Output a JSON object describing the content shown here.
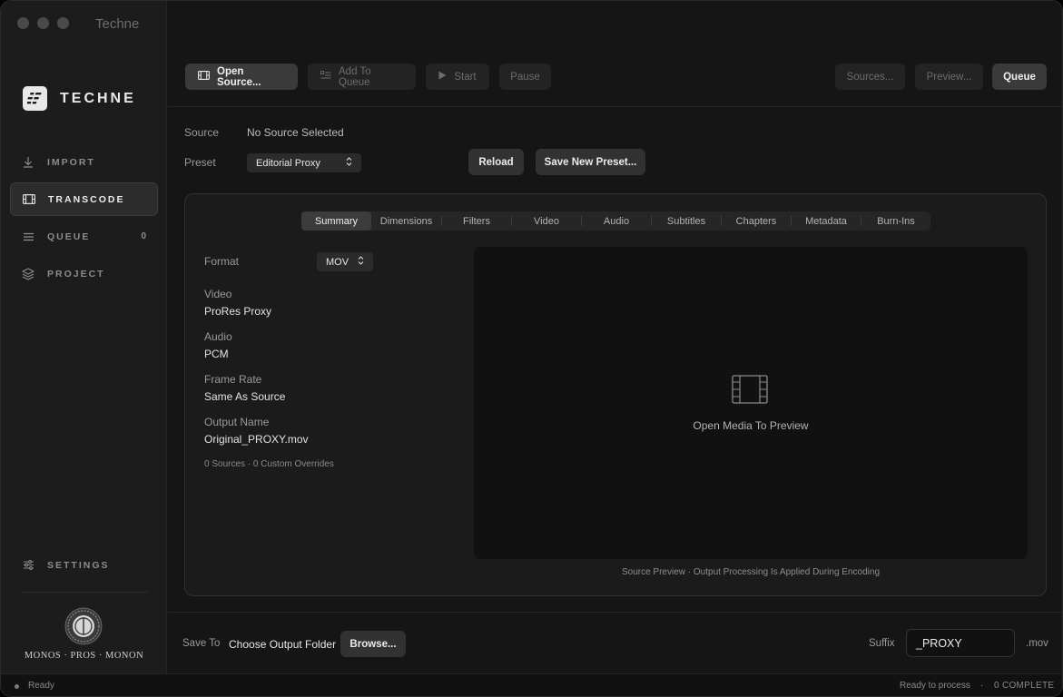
{
  "window": {
    "title": "Techne"
  },
  "brand": {
    "name": "TECHNE",
    "motto": "MONOS · PROS · MONON"
  },
  "sidebar": {
    "items": [
      {
        "label": "IMPORT",
        "icon": "download-icon"
      },
      {
        "label": "TRANSCODE",
        "icon": "film-icon",
        "active": true
      },
      {
        "label": "QUEUE",
        "icon": "list-icon",
        "count": "0"
      },
      {
        "label": "PROJECT",
        "icon": "layers-icon"
      }
    ],
    "settings": {
      "label": "SETTINGS",
      "icon": "sliders-icon"
    }
  },
  "toolbar": {
    "open_source": "Open Source...",
    "add_to_queue": "Add To Queue",
    "start": "Start",
    "pause": "Pause",
    "sources": "Sources...",
    "preview": "Preview...",
    "queue": "Queue"
  },
  "source": {
    "label": "Source",
    "value": "No Source Selected"
  },
  "preset": {
    "label": "Preset",
    "selected": "Editorial Proxy",
    "reload": "Reload",
    "save_new": "Save New Preset..."
  },
  "tabs": [
    "Summary",
    "Dimensions",
    "Filters",
    "Video",
    "Audio",
    "Subtitles",
    "Chapters",
    "Metadata",
    "Burn-Ins"
  ],
  "summary": {
    "format_label": "Format",
    "format_value": "MOV",
    "video_label": "Video",
    "video_value": "ProRes Proxy",
    "audio_label": "Audio",
    "audio_value": "PCM",
    "framerate_label": "Frame Rate",
    "framerate_value": "Same As Source",
    "output_label": "Output Name",
    "output_value": "Original_PROXY.mov",
    "counts": "0 Sources · 0 Custom Overrides"
  },
  "preview": {
    "empty_text": "Open Media To Preview",
    "caption": "Source Preview · Output Processing Is Applied During Encoding"
  },
  "output": {
    "save_to_label": "Save To",
    "folder": "Choose Output Folder",
    "browse": "Browse...",
    "suffix_label": "Suffix",
    "suffix_value": "_PROXY",
    "extension": ".mov"
  },
  "status": {
    "left": "Ready",
    "right_status": "Ready to process",
    "separator": "·",
    "complete": "0 COMPLETE"
  }
}
